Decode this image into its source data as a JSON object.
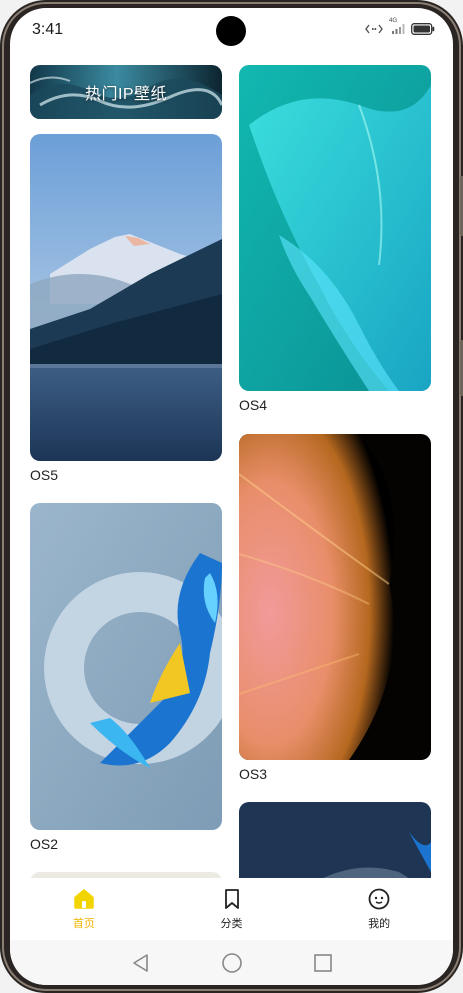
{
  "status_bar": {
    "time": "3:41",
    "network_badge": "4G",
    "icons": [
      "vibrate-icon",
      "signal-icon",
      "battery-icon"
    ]
  },
  "banner": {
    "label": "热门IP壁纸"
  },
  "wallpapers": {
    "left": [
      {
        "name": "OS5",
        "image": "mountain-lake"
      },
      {
        "name": "OS2",
        "image": "blue-fish-ring"
      }
    ],
    "right": [
      {
        "name": "OS4",
        "image": "teal-wave"
      },
      {
        "name": "OS3",
        "image": "pink-feather"
      }
    ]
  },
  "tabs": [
    {
      "label": "首页",
      "icon": "home-icon",
      "active": true
    },
    {
      "label": "分类",
      "icon": "bookmark-icon",
      "active": false
    },
    {
      "label": "我的",
      "icon": "smile-face-icon",
      "active": false
    }
  ],
  "system_nav": [
    "back-icon",
    "home-circle-icon",
    "recents-icon"
  ],
  "colors": {
    "accent": "#f2b400",
    "text": "#222222",
    "background": "#ffffff"
  }
}
